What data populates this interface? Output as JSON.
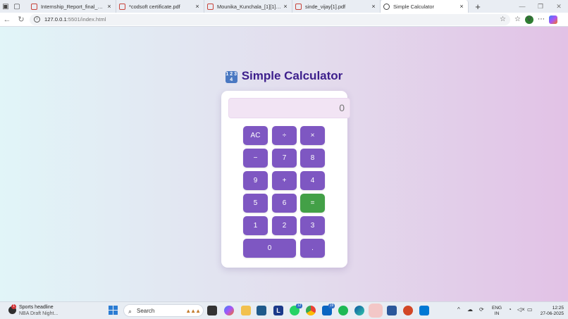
{
  "browser": {
    "tabs": [
      {
        "title": "Internship_Report_final_250625_...",
        "icon": "pdf-icon"
      },
      {
        "title": "*codsoft certificate.pdf",
        "icon": "pdf-icon"
      },
      {
        "title": "Mounika_Kunchala_[1][1].pdf",
        "icon": "pdf-icon"
      },
      {
        "title": "sinde_vijay[1].pdf",
        "icon": "pdf-icon"
      },
      {
        "title": "Simple Calculator",
        "icon": "globe-icon",
        "active": true
      }
    ],
    "close_glyph": "×",
    "new_tab_glyph": "+",
    "url_host": "127.0.0.1",
    "url_rest": ":5501/index.html",
    "profile_initial": "V"
  },
  "app": {
    "title": "Simple Calculator",
    "emoji_text": "1 2 3 4",
    "display": "0",
    "keys": [
      "AC",
      "÷",
      "×",
      "−",
      "7",
      "8",
      "9",
      "+",
      "4",
      "5",
      "6",
      "=",
      "1",
      "2",
      "3",
      "0",
      "."
    ]
  },
  "taskbar": {
    "weather_badge": "1",
    "headline_title": "Sports headline",
    "headline_sub": "NBA Draft Night...",
    "search_placeholder": "Search",
    "linkedin_badge": "19",
    "whatsapp_badge": "12",
    "lang_line1": "ENG",
    "lang_line2": "IN",
    "time": "12:25",
    "date": "27-06-2025"
  },
  "colors": {
    "accent_purple": "#7e57c2",
    "equals_green": "#43a047",
    "title_color": "#3d1f8c",
    "display_bg": "#f2e4f4"
  }
}
